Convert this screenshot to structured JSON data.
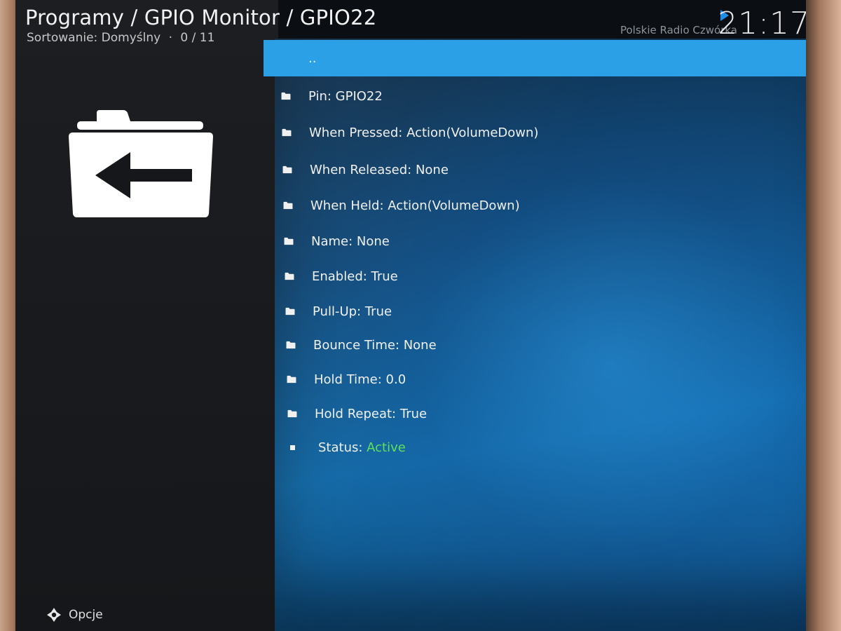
{
  "header": {
    "breadcrumb": "Programy / GPIO Monitor / GPIO22",
    "sort_label": "Sortowanie: Domyślny",
    "separator": "·",
    "position": "0 / 11"
  },
  "now_playing": {
    "station": "Polskie Radio Czwórka",
    "icon": "play-icon"
  },
  "clock": "21:17",
  "list": {
    "parent": "..",
    "items": [
      {
        "label": "Pin: GPIO22",
        "icon": "folder-icon"
      },
      {
        "label": "When Pressed: Action(VolumeDown)",
        "icon": "folder-icon"
      },
      {
        "label": "When Released: None",
        "icon": "folder-icon"
      },
      {
        "label": "When Held: Action(VolumeDown)",
        "icon": "folder-icon"
      },
      {
        "label": "Name: None",
        "icon": "folder-icon"
      },
      {
        "label": "Enabled: True",
        "icon": "folder-icon"
      },
      {
        "label": "Pull-Up: True",
        "icon": "folder-icon"
      },
      {
        "label": "Bounce Time: None",
        "icon": "folder-icon"
      },
      {
        "label": "Hold Time: 0.0",
        "icon": "folder-icon"
      },
      {
        "label": "Hold Repeat: True",
        "icon": "folder-icon"
      }
    ],
    "status": {
      "label": "Status: ",
      "value": "Active",
      "value_color": "#5fe05a",
      "icon": "bullet-icon"
    }
  },
  "footer": {
    "options_label": "Opcje",
    "options_icon": "options-icon"
  },
  "colors": {
    "selection": "#2ba0e6",
    "accent_play": "#1e90e8"
  }
}
